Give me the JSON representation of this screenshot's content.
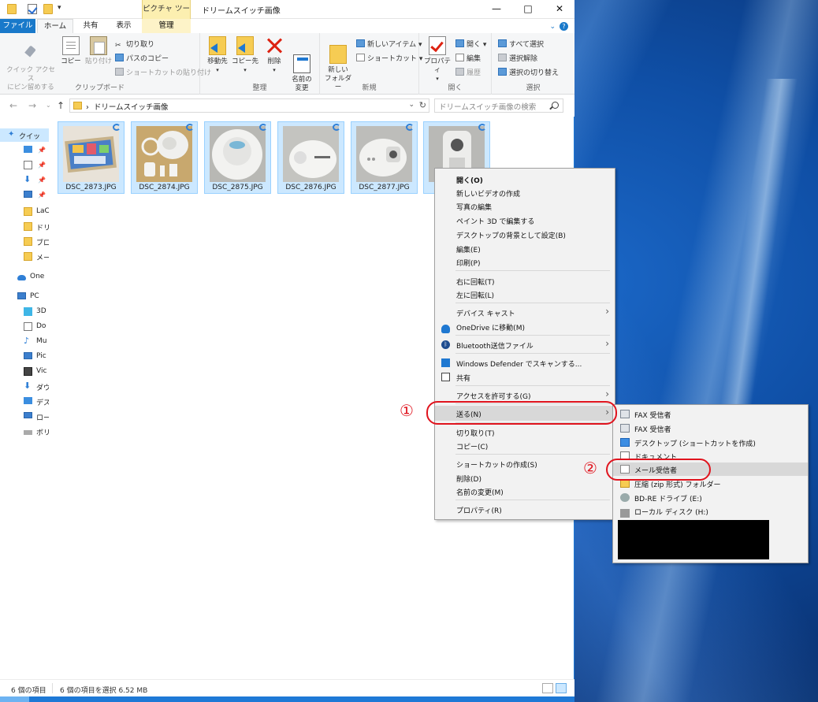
{
  "window": {
    "title": "ドリームスイッチ画像",
    "context_tab": "ピクチャ ツール"
  },
  "ribbon_tabs": {
    "file": "ファイル",
    "home": "ホーム",
    "share": "共有",
    "view": "表示",
    "manage": "管理"
  },
  "ribbon": {
    "clipboard": {
      "label": "クリップボード",
      "pin": "クイック アクセス\nにピン留めする",
      "copy": "コピー",
      "paste": "貼り付け",
      "cut": "切り取り",
      "copy_path": "パスのコピー",
      "paste_shortcut": "ショートカットの貼り付け"
    },
    "organize": {
      "label": "整理",
      "move_to": "移動先",
      "copy_to": "コピー先",
      "delete": "削除",
      "rename": "名前の\n変更"
    },
    "new": {
      "label": "新規",
      "new_folder": "新しい\nフォルダー",
      "new_item": "新しいアイテム ▾",
      "easy_access": "ショートカット ▾"
    },
    "open": {
      "label": "開く",
      "properties": "プロパティ",
      "open": "開く ▾",
      "edit": "編集",
      "history": "履歴"
    },
    "select": {
      "label": "選択",
      "select_all": "すべて選択",
      "select_none": "選択解除",
      "invert": "選択の切り替え"
    }
  },
  "address": {
    "path": "ドリームスイッチ画像",
    "search_placeholder": "ドリームスイッチ画像の検索"
  },
  "nav": [
    {
      "label": "クイッ",
      "icon": "star-icon"
    },
    {
      "label": "",
      "icon": "desktop-icon"
    },
    {
      "label": "",
      "icon": "document-icon"
    },
    {
      "label": "",
      "icon": "download-icon"
    },
    {
      "label": "",
      "icon": "picture-icon"
    },
    {
      "label": "LaC",
      "icon": "folder-icon"
    },
    {
      "label": "ドリ",
      "icon": "folder-icon"
    },
    {
      "label": "ブロ",
      "icon": "folder-icon"
    },
    {
      "label": "メー",
      "icon": "folder-icon"
    },
    {
      "label": "One",
      "icon": "onedrive-icon"
    },
    {
      "label": "PC",
      "icon": "pc-icon"
    },
    {
      "label": "3D",
      "icon": "3d-objects-icon"
    },
    {
      "label": "Do",
      "icon": "document-icon"
    },
    {
      "label": "Mu",
      "icon": "music-icon"
    },
    {
      "label": "Pic",
      "icon": "picture-icon"
    },
    {
      "label": "Vic",
      "icon": "video-icon"
    },
    {
      "label": "ダウ",
      "icon": "download-icon"
    },
    {
      "label": "デス",
      "icon": "desktop-icon"
    },
    {
      "label": "ロー",
      "icon": "drive-icon"
    },
    {
      "label": "ボリ",
      "icon": "drive-icon"
    }
  ],
  "files": [
    {
      "name": "DSC_2873.JPG"
    },
    {
      "name": "DSC_2874.JPG"
    },
    {
      "name": "DSC_2875.JPG"
    },
    {
      "name": "DSC_2876.JPG"
    },
    {
      "name": "DSC_2877.JPG"
    },
    {
      "name": ""
    }
  ],
  "status": {
    "count": "6 個の項目",
    "selected": "6 個の項目を選択  6.52 MB"
  },
  "context_menu": [
    {
      "label": "開く(O)",
      "bold": true
    },
    {
      "label": "新しいビデオの作成"
    },
    {
      "label": "写真の編集"
    },
    {
      "label": "ペイント 3D で編集する"
    },
    {
      "label": "デスクトップの背景として設定(B)"
    },
    {
      "label": "編集(E)"
    },
    {
      "label": "印刷(P)"
    },
    {
      "label": "右に回転(T)"
    },
    {
      "label": "左に回転(L)"
    },
    {
      "label": "デバイス キャスト"
    },
    {
      "label": "OneDrive に移動(M)"
    },
    {
      "label": "Bluetooth送信ファイル"
    },
    {
      "label": "Windows Defender でスキャンする..."
    },
    {
      "label": "共有"
    },
    {
      "label": "アクセスを許可する(G)"
    },
    {
      "label": "送る(N)"
    },
    {
      "label": "切り取り(T)"
    },
    {
      "label": "コピー(C)"
    },
    {
      "label": "ショートカットの作成(S)"
    },
    {
      "label": "削除(D)"
    },
    {
      "label": "名前の変更(M)"
    },
    {
      "label": "プロパティ(R)"
    }
  ],
  "send_to": [
    {
      "label": "FAX 受信者"
    },
    {
      "label": "FAX 受信者"
    },
    {
      "label": "デスクトップ (ショートカットを作成)"
    },
    {
      "label": "ドキュメント"
    },
    {
      "label": "メール受信者"
    },
    {
      "label": "圧縮 (zip 形式) フォルダー"
    },
    {
      "label": "BD-RE ドライブ (E:)"
    },
    {
      "label": "ローカル ディスク (H:)"
    }
  ],
  "annotations": {
    "step1": "①",
    "step2": "②"
  },
  "colors": {
    "accent": "#1979ca",
    "selection": "#cce8ff",
    "annotation": "#e0141e"
  }
}
